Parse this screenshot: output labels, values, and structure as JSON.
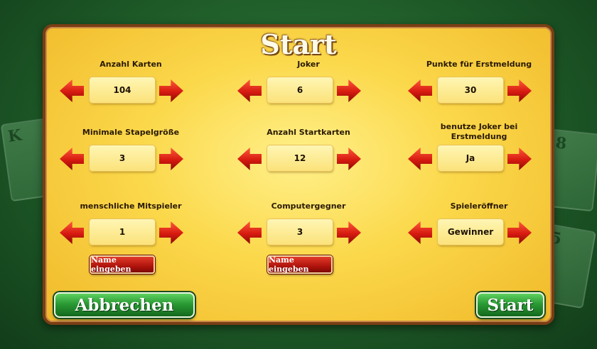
{
  "title": "Start",
  "settings": [
    {
      "label": "Anzahl Karten",
      "value": "104"
    },
    {
      "label": "Joker",
      "value": "6"
    },
    {
      "label": "Punkte für Erstmeldung",
      "value": "30"
    },
    {
      "label": "Minimale Stapelgröße",
      "value": "3"
    },
    {
      "label": "Anzahl Startkarten",
      "value": "12"
    },
    {
      "label": "benutze Joker bei Erstmeldung",
      "value": "Ja"
    },
    {
      "label": "menschliche Mitspieler",
      "value": "1"
    },
    {
      "label": "Computergegner",
      "value": "3"
    },
    {
      "label": "Spieleröffner",
      "value": "Gewinner"
    }
  ],
  "name_button_label": "Name eingeben",
  "cancel_label": "Abbrechen",
  "start_label": "Start",
  "background_cards": [
    "K",
    "8",
    "5"
  ],
  "colors": {
    "panel": "#fbd84a",
    "arrow": "#d61a10",
    "button_green": "#2a9a34",
    "felt": "#1e5a28"
  }
}
